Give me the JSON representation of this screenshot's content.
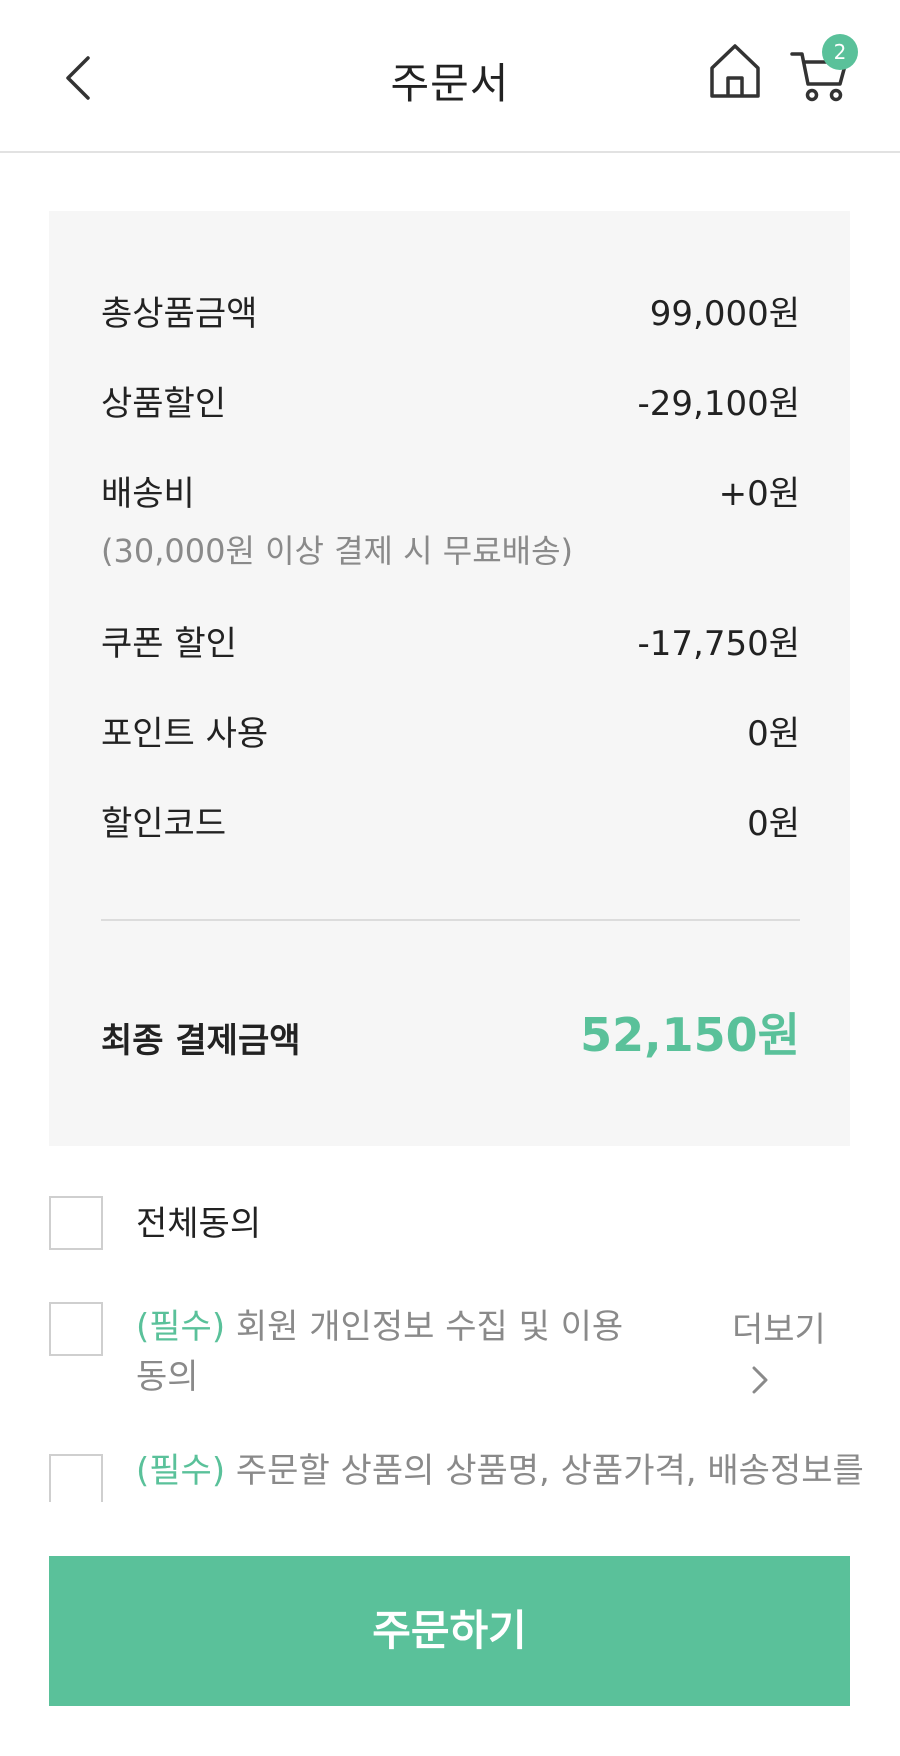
{
  "header": {
    "title": "주문서",
    "cart_count": "2",
    "icons": {
      "back": "chevron-left-icon",
      "home": "home-icon",
      "cart": "cart-icon"
    }
  },
  "summary": {
    "total_product": {
      "label": "총상품금액",
      "value": "99,000원"
    },
    "product_discount": {
      "label": "상품할인",
      "value": "-29,100원"
    },
    "shipping": {
      "label": "배송비",
      "value": "+0원",
      "note": "(30,000원 이상 결제 시 무료배송)"
    },
    "coupon_discount": {
      "label": "쿠폰 할인",
      "value": "-17,750원"
    },
    "points": {
      "label": "포인트 사용",
      "value": "0원"
    },
    "discount_code": {
      "label": "할인코드",
      "value": "0원"
    },
    "final": {
      "label": "최종 결제금액",
      "value": "52,150원"
    }
  },
  "agreements": {
    "all": {
      "label": "전체동의",
      "checked": false
    },
    "items": [
      {
        "required_tag": "(필수)",
        "text_line1": " 회원 개인정보 수집 및 이용",
        "text_line2": "동의",
        "more": "더보기",
        "checked": false
      },
      {
        "required_tag": "(필수)",
        "text_line1": " 주문할 상품의 상품명, 상품가격, 배송정보를",
        "checked": false
      }
    ]
  },
  "order_button": {
    "label": "주문하기"
  },
  "colors": {
    "accent": "#5ac19a",
    "panel": "#f6f6f6",
    "muted": "#8a8a8a"
  }
}
